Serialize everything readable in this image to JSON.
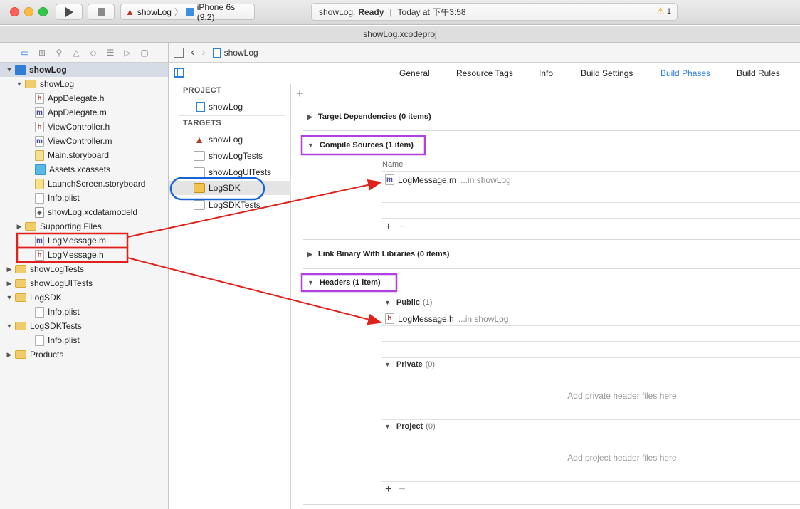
{
  "window": {
    "scheme_target": "showLog",
    "scheme_device": "iPhone 6s (9.2)",
    "activity_app": "showLog:",
    "activity_status": "Ready",
    "activity_separator": "|",
    "activity_time": "Today at 下午3:58",
    "warning_count": "1",
    "document_title": "showLog.xcodeproj"
  },
  "navigator": {
    "tabs": [
      "folder-icon",
      "hierarchy-icon",
      "search-icon",
      "warning-icon",
      "test-icon",
      "debug-icon",
      "breakpoint-icon",
      "report-icon"
    ],
    "items": [
      {
        "label": "showLog",
        "icon": "project-icon"
      },
      {
        "label": "showLog",
        "icon": "folder-icon"
      },
      {
        "label": "AppDelegate.h",
        "icon": "h-file-icon"
      },
      {
        "label": "AppDelegate.m",
        "icon": "m-file-icon"
      },
      {
        "label": "ViewController.h",
        "icon": "h-file-icon"
      },
      {
        "label": "ViewController.m",
        "icon": "m-file-icon"
      },
      {
        "label": "Main.storyboard",
        "icon": "storyboard-icon"
      },
      {
        "label": "Assets.xcassets",
        "icon": "assets-icon"
      },
      {
        "label": "LaunchScreen.storyboard",
        "icon": "storyboard-icon"
      },
      {
        "label": "Info.plist",
        "icon": "plist-icon"
      },
      {
        "label": "showLog.xcdatamodeld",
        "icon": "datamodel-icon"
      },
      {
        "label": "Supporting Files",
        "icon": "folder-icon"
      },
      {
        "label": "LogMessage.m",
        "icon": "m-file-icon"
      },
      {
        "label": "LogMessage.h",
        "icon": "h-file-icon"
      },
      {
        "label": "showLogTests",
        "icon": "folder-icon"
      },
      {
        "label": "showLogUITests",
        "icon": "folder-icon"
      },
      {
        "label": "LogSDK",
        "icon": "folder-icon"
      },
      {
        "label": "Info.plist",
        "icon": "plist-icon"
      },
      {
        "label": "LogSDKTests",
        "icon": "folder-icon"
      },
      {
        "label": "Info.plist",
        "icon": "plist-icon"
      },
      {
        "label": "Products",
        "icon": "folder-icon"
      }
    ]
  },
  "jumpbar": {
    "project": "showLog"
  },
  "editor_tabs": [
    "General",
    "Resource Tags",
    "Info",
    "Build Settings",
    "Build Phases",
    "Build Rules"
  ],
  "targets_panel": {
    "project_header": "PROJECT",
    "project": "showLog",
    "targets_header": "TARGETS",
    "targets": [
      "showLog",
      "showLogTests",
      "showLogUITests",
      "LogSDK",
      "LogSDKTests"
    ]
  },
  "phases": {
    "add_symbol": "+",
    "target_dependencies": "Target Dependencies (0 items)",
    "compile_sources": "Compile Sources (1 item)",
    "name_column": "Name",
    "compile_file": "LogMessage.m",
    "compile_file_location": "...in showLog",
    "link_binary": "Link Binary With Libraries (0 items)",
    "headers": "Headers (1 item)",
    "public_label": "Public",
    "public_count": "(1)",
    "header_file": "LogMessage.h",
    "header_file_location": "...in showLog",
    "private_label": "Private",
    "private_count": "(0)",
    "private_placeholder": "Add private header files here",
    "project_label": "Project",
    "project_count": "(0)",
    "project_placeholder": "Add project header files here",
    "plus": "+",
    "minus": "−"
  },
  "colors": {
    "accent": "#2a7de1",
    "annotation_red": "#e0201b",
    "annotation_purple": "#b040e0",
    "annotation_blue": "#1a63d6"
  }
}
